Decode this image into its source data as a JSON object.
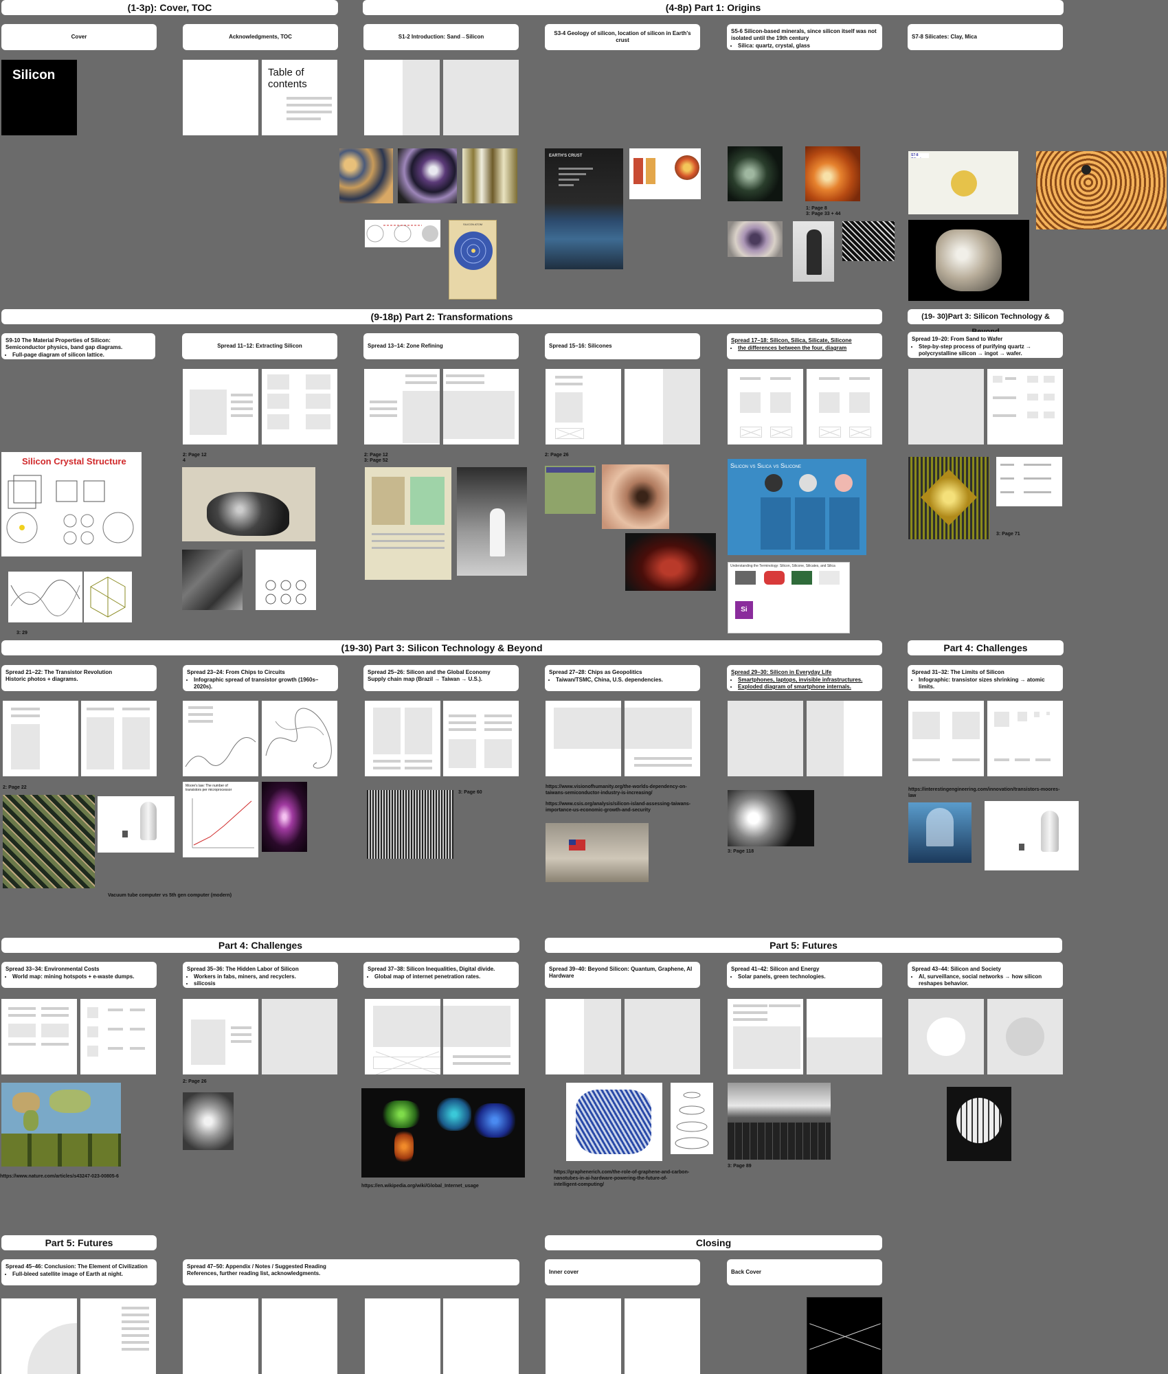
{
  "headers": {
    "cover_toc": "(1-3p): Cover, TOC",
    "part1": "(4-8p) Part 1: Origins",
    "part2": "(9-18p) Part 2: Transformations",
    "part3a": "(19- 30)Part 3: Silicon Technology & Beyond",
    "part3b": "(19-30) Part 3: Silicon Technology & Beyond",
    "part4a": "Part 4: Challenges",
    "part4b": "Part 4: Challenges",
    "part5a": "Part 5: Futures",
    "part5b": "Part 5: Futures",
    "closing": "Closing"
  },
  "cards": {
    "cover": "Cover",
    "ack": "Acknowledgments, TOC",
    "s1": "S1-2 Introduction: Sand→Silicon",
    "s3": "S3-4 Geology of silicon, location of silicon in Earth's crust",
    "s5_title": "S5-6 Silicon-based minerals, since silicon itself was not isolated until the 19th century",
    "s5_bullet": "Silica: quartz, crystal, glass",
    "s7": "S7-8 Silicates: Clay, Mica",
    "s9_title": "S9-10 The Material Properties of Silicon: Semiconductor physics, band gap diagrams.",
    "s9_bullet": "Full-page diagram of silicon lattice.",
    "s11": "Spread 11–12: Extracting Silicon",
    "s13": "Spread 13–14: Zone Refining",
    "s15": "Spread 15–16: Silicones",
    "s17_title": "Spread 17–18: Silicon, Silica, Silicate, Silicone",
    "s17_bullet": "the differences between the four, diagram",
    "s19_title": "Spread 19–20: From Sand to Wafer",
    "s19_bullet": "Step-by-step process of purifying quartz → polycrystalline silicon → ingot → wafer.",
    "s21_title": "Spread 21–22: The Transistor Revolution",
    "s21_sub": "Historic photos + diagrams.",
    "s23_title": "Spread 23–24: From Chips to Circuits",
    "s23_bullet": "Infographic spread of transistor growth (1960s–2020s).",
    "s25_title": "Spread 25–26: Silicon and the Global Economy",
    "s25_sub": "Supply chain map (Brazil → Taiwan → U.S.).",
    "s27_title": "Spread 27–28: Chips as Geopolitics",
    "s27_bullet": "Taiwan/TSMC, China, U.S. dependencies.",
    "s29_title": "Spread 29–30: Silicon in Everyday Life",
    "s29_b1": "Smartphones, laptops, invisible infrastructures.",
    "s29_b2": "Exploded diagram of smartphone internals.",
    "s31_title": "Spread 31–32: The Limits of Silicon",
    "s31_bullet": "Infographic: transistor sizes shrinking → atomic limits.",
    "s33_title": "Spread 33–34: Environmental Costs",
    "s33_bullet": "World map: mining hotspots + e-waste dumps.",
    "s35_title": "Spread 35–36: The Hidden Labor of Silicon",
    "s35_b1": "Workers in fabs, miners, and recyclers.",
    "s35_b2": "silicosis",
    "s37_title": "Spread 37–38: Silicon Inequalities, Digital divide.",
    "s37_bullet": "Global map of internet penetration rates.",
    "s39": "Spread 39–40: Beyond Silicon: Quantum, Graphene, AI Hardware",
    "s41_title": "Spread 41–42: Silicon and Energy",
    "s41_bullet": "Solar panels, green technologies.",
    "s43_title": "Spread 43–44: Silicon and Society",
    "s43_bullet": "AI, surveillance, social networks → how silicon reshapes behavior.",
    "s45_title": "Spread 45–46: Conclusion: The Element of Civilization",
    "s45_bullet": "Full-bleed satellite image of Earth at night.",
    "s47_title": "Spread 47–50: Appendix / Notes / Suggested Reading",
    "s47_sub": "References, further reading list, acknowledgments.",
    "inner_cover": "Inner cover",
    "back_cover": "Back Cover"
  },
  "pages": {
    "cover_title": "Silicon",
    "toc_title": "Table of contents"
  },
  "images": {
    "crystal_title": "Silicon Crystal Structure",
    "vs_title": "Silicon vs Silica vs Silicone",
    "understanding_title": "Understanding the Terminology: Silicon, Silicone, Silicates, and Silica",
    "si_symbol": "Si",
    "earth_crust": "EARTH'S CRUST",
    "silicon_atom": "SILICON ATOM",
    "atom_label": "Silicon",
    "moores_title": "Moore's law: The number of transistors per microprocessor"
  },
  "notes": {
    "n_p8": "1: Page 8",
    "n_p33": "3: Page 33 + 44",
    "n_p12a": "2: Page 12",
    "n_4": "4",
    "n_p12b": "2: Page 12",
    "n_p52": "3: Page 52",
    "n_p26a": "2: Page 26",
    "n_p71": "3: Page 71",
    "n_329": "3: 29",
    "n_p22": "2: Page 22",
    "n_p60": "3: Page 60",
    "n_p118": "3: Page 118",
    "n_p26b": "2: Page 26",
    "n_p89": "3: Page 89",
    "vacuum": "Vacuum tube computer vs 5th gen computer (modern)"
  },
  "urls": {
    "u1": "https://www.visionofhumanity.org/the-worlds-dependency-on-taiwans-semiconductor-industry-is-increasing/",
    "u2": "https://www.csis.org/analysis/silicon-island-assessing-taiwans-importance-us-economic-growth-and-security",
    "u3": "https://interestingengineering.com/innovation/transistors-moores-law",
    "u4": "https://www.nature.com/articles/s43247-023-00805-6",
    "u5": "https://en.wikipedia.org/wiki/Global_Internet_usage",
    "u6": "https://graphenerich.com/the-role-of-graphene-and-carbon-nanotubes-in-ai-hardware-powering-the-future-of-intelligent-computing/"
  }
}
